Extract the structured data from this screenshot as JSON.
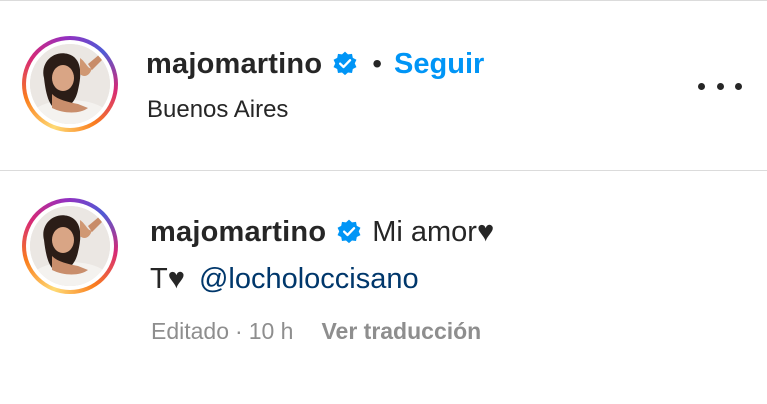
{
  "header": {
    "username": "majomartino",
    "separator": "•",
    "follow_label": "Seguir",
    "location": "Buenos Aires",
    "more_icon": "more-horizontal-icon"
  },
  "comment": {
    "username": "majomartino",
    "caption_line1": "Mi amor♥",
    "caption_line2": "T♥",
    "mention": "@locholoccisano",
    "edited_label": "Editado",
    "meta_separator": "·",
    "time": "10 h",
    "translate_label": "Ver traducción"
  },
  "colors": {
    "link_blue": "#0095f6",
    "mention_blue": "#00376b",
    "verified_blue": "#0095f6",
    "muted_gray": "#8e8e8e",
    "text": "#262626"
  }
}
